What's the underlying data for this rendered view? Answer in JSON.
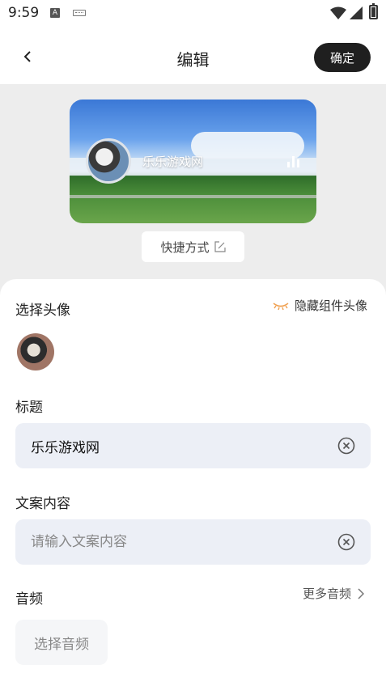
{
  "status_bar": {
    "time": "9:59",
    "a_badge": "A"
  },
  "app_bar": {
    "title": "编辑",
    "confirm_label": "确定"
  },
  "preview": {
    "name": "乐乐游戏网",
    "shortcut_label": "快捷方式"
  },
  "avatar_section": {
    "label": "选择头像",
    "hide_label": "隐藏组件头像"
  },
  "title_section": {
    "label": "标题",
    "value": "乐乐游戏网"
  },
  "copy_section": {
    "label": "文案内容",
    "placeholder": "请输入文案内容",
    "value": ""
  },
  "audio_section": {
    "label": "音频",
    "more_label": "更多音频",
    "choose_label": "选择音频"
  },
  "colors": {
    "confirm_bg": "#1f1f1f",
    "field_bg": "#eceff6",
    "hide_icon": "#f0a050"
  },
  "icons": [
    "back-arrow-icon",
    "edit-icon",
    "eye-closed-icon",
    "clear-icon",
    "chevron-right-icon",
    "bar-chart-icon",
    "wifi-icon",
    "cell-signal-icon",
    "battery-icon"
  ]
}
